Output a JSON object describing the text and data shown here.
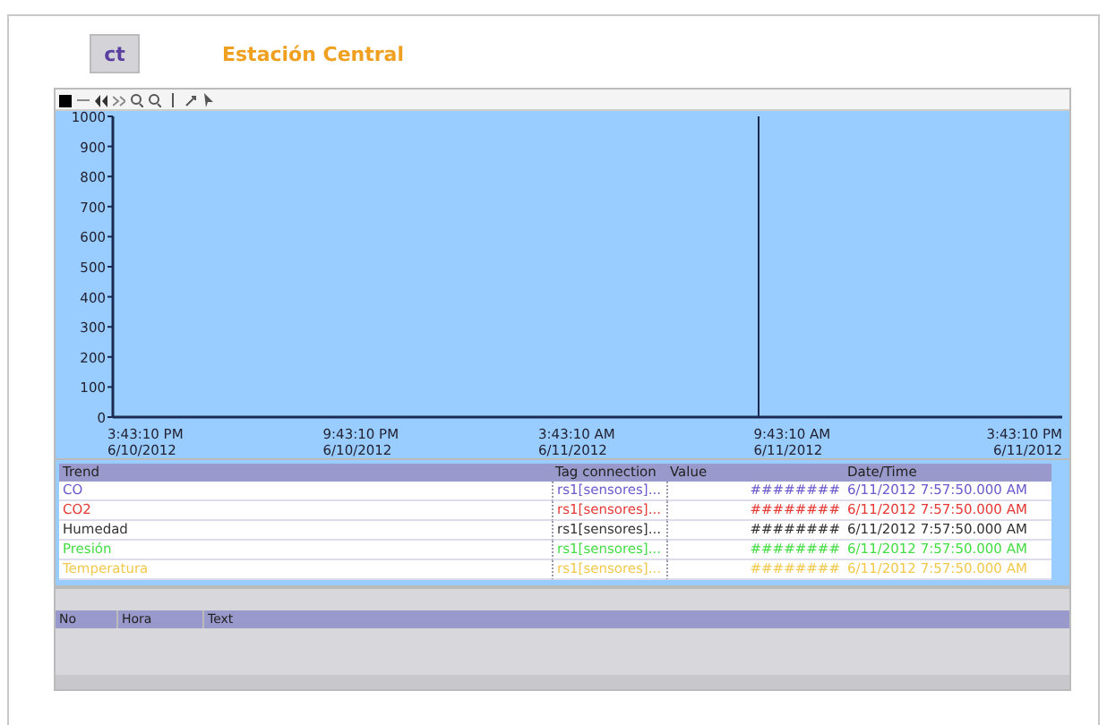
{
  "header": {
    "button": "ct",
    "title": "Estación Central"
  },
  "chart": {
    "chart_data": {
      "type": "line",
      "ylim": [
        0,
        1000
      ],
      "yticks": [
        0,
        100,
        200,
        300,
        400,
        500,
        600,
        700,
        800,
        900,
        1000
      ],
      "categories": [
        "3:43:10 PM 6/10/2012",
        "9:43:10 PM 6/10/2012",
        "3:43:10 AM 6/11/2012",
        "9:43:10 AM 6/11/2012",
        "3:43:10 PM 6/11/2012"
      ]
    }
  },
  "trend_table": {
    "columns": [
      "Trend",
      "Tag connection",
      "Value",
      "Date/Time"
    ],
    "rows": [
      {
        "trend": "CO",
        "tag": "rs1[sensores]...",
        "value": "########",
        "datetime": "6/11/2012 7:57:50.000 AM",
        "color": "#6a5acd"
      },
      {
        "trend": "CO2",
        "tag": "rs1[sensores]...",
        "value": "########",
        "datetime": "6/11/2012 7:57:50.000 AM",
        "color": "#e53935"
      },
      {
        "trend": "Humedad",
        "tag": "rs1[sensores]...",
        "value": "########",
        "datetime": "6/11/2012 7:57:50.000 AM",
        "color": "#333333"
      },
      {
        "trend": "Presión",
        "tag": "rs1[sensores]...",
        "value": "########",
        "datetime": "6/11/2012 7:57:50.000 AM",
        "color": "#44dd44"
      },
      {
        "trend": "Temperatura",
        "tag": "rs1[sensores]...",
        "value": "########",
        "datetime": "6/11/2012 7:57:50.000 AM",
        "color": "#f2c94c"
      }
    ]
  },
  "alarm_table": {
    "columns": [
      "No",
      "Hora",
      "Text"
    ]
  }
}
